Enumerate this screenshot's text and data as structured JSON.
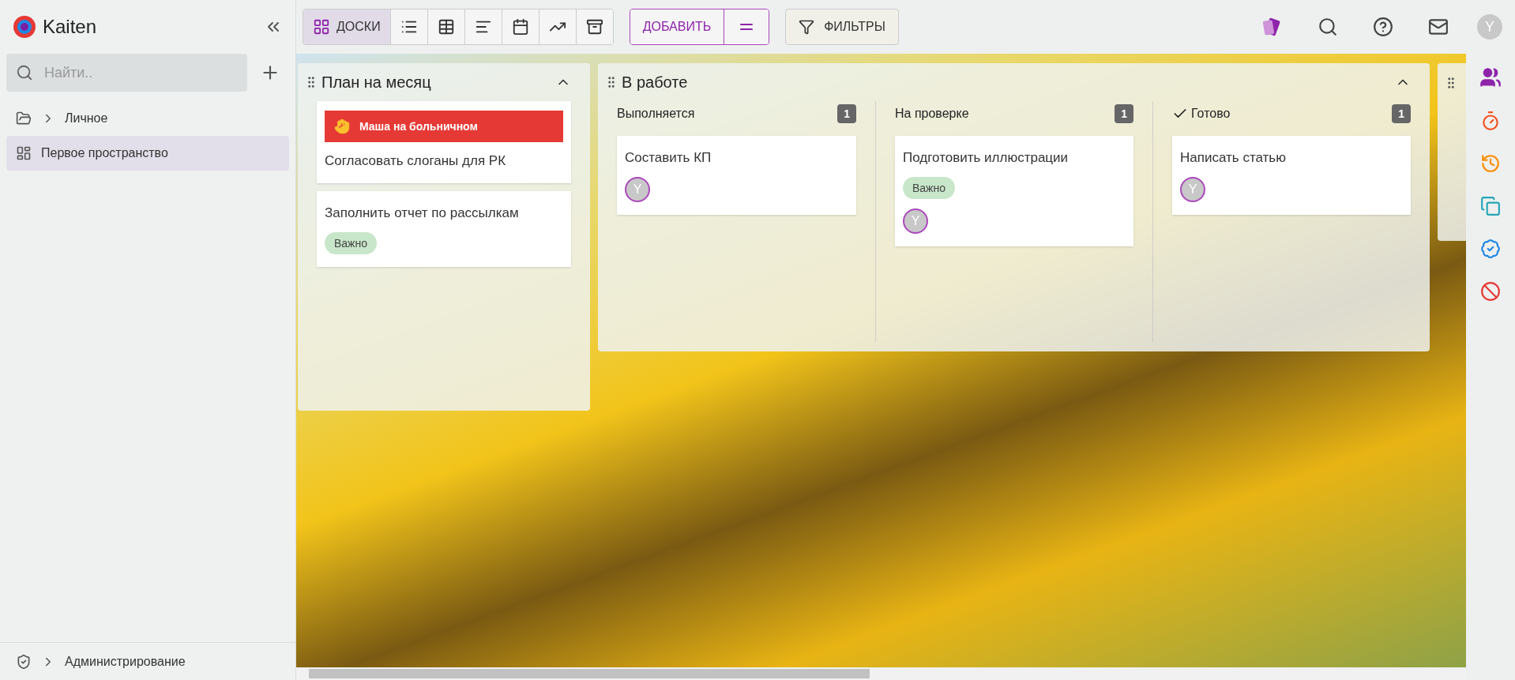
{
  "sidebar": {
    "logo_text": "Kaiten",
    "search": {
      "placeholder": "Найти.."
    },
    "items": [
      {
        "kind": "folder",
        "label": "Личное",
        "selected": false,
        "expanded": false
      },
      {
        "kind": "space",
        "label": "Первое пространство",
        "selected": true
      }
    ],
    "footer": {
      "label": "Администрирование",
      "expanded": false
    }
  },
  "toolbar": {
    "views": [
      {
        "kind": "boards",
        "label": "ДОСКИ",
        "selected": true
      },
      {
        "kind": "list",
        "selected": false
      },
      {
        "kind": "table",
        "selected": false
      },
      {
        "kind": "sort",
        "selected": false
      },
      {
        "kind": "calendar",
        "selected": false
      },
      {
        "kind": "chart",
        "selected": false
      },
      {
        "kind": "archive",
        "selected": false
      }
    ],
    "add_button": "ДОБАВИТЬ",
    "filter_button": "ФИЛЬТРЫ",
    "user_avatar": "Y"
  },
  "board": {
    "columns": [
      {
        "title": "План на месяц",
        "expanded": true,
        "cards": [
          {
            "blocker": "Маша на больничном",
            "title": "Согласовать слоганы для РК"
          },
          {
            "title": "Заполнить отчет по рассылкам",
            "tags": [
              "Важно"
            ]
          }
        ]
      },
      {
        "title": "В работе",
        "expanded": true,
        "lanes": [
          {
            "title": "Выполняется",
            "count": "1",
            "done": false,
            "cards": [
              {
                "title": "Составить КП",
                "avatar": "Y"
              }
            ]
          },
          {
            "title": "На проверке",
            "count": "1",
            "done": false,
            "cards": [
              {
                "title": "Подготовить иллюстрации",
                "tags": [
                  "Важно"
                ],
                "avatar": "Y"
              }
            ]
          },
          {
            "title": "Готово",
            "count": "1",
            "done": true,
            "cards": [
              {
                "title": "Написать статью",
                "avatar": "Y"
              }
            ]
          }
        ]
      }
    ]
  }
}
